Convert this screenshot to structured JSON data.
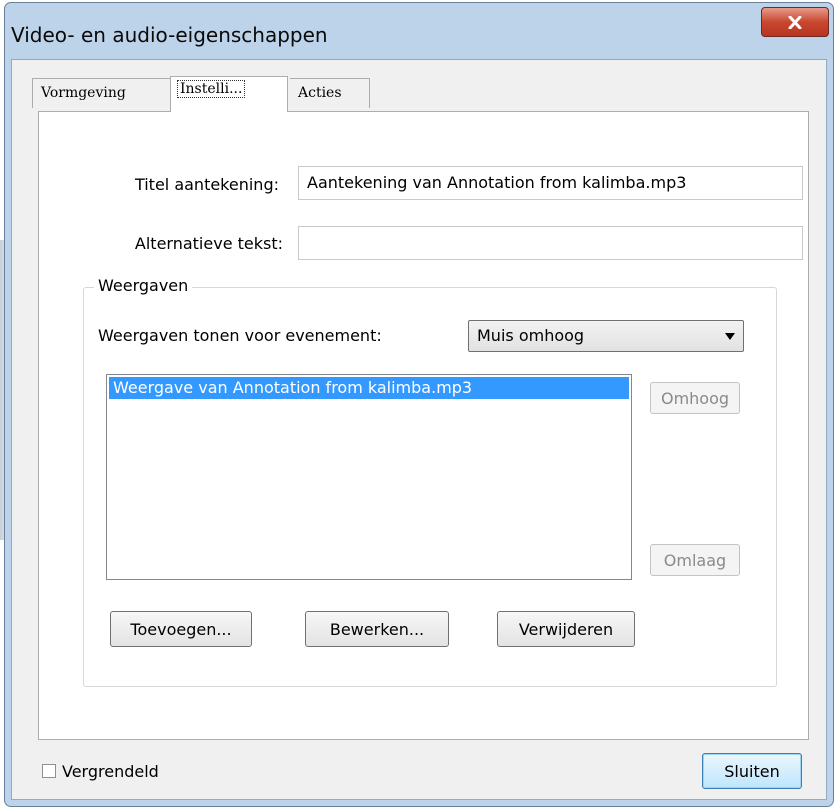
{
  "window": {
    "title": "Video- en audio-eigenschappen",
    "close_icon": "close-icon"
  },
  "tabs": [
    {
      "label": "Vormgeving",
      "selected": false
    },
    {
      "label": "Instelli...",
      "selected": true
    },
    {
      "label": "Acties",
      "selected": false
    }
  ],
  "settings": {
    "title_label": "Titel aantekening:",
    "title_value": "Aantekening van Annotation from kalimba.mp3",
    "alt_label": "Alternatieve tekst:",
    "alt_value": ""
  },
  "renditions": {
    "group_title": "Weergaven",
    "event_label": "Weergaven tonen voor evenement:",
    "event_selected": "Muis omhoog",
    "list_items": [
      "Weergave van Annotation from kalimba.mp3"
    ],
    "up_label": "Omhoog",
    "down_label": "Omlaag",
    "add_label": "Toevoegen...",
    "edit_label": "Bewerken...",
    "delete_label": "Verwijderen"
  },
  "footer": {
    "locked_label": "Vergrendeld",
    "locked_checked": false,
    "close_label": "Sluiten"
  },
  "colors": {
    "selection": "#3399ff",
    "frame": "#bcd3ea",
    "close_button": "#c9472f"
  }
}
